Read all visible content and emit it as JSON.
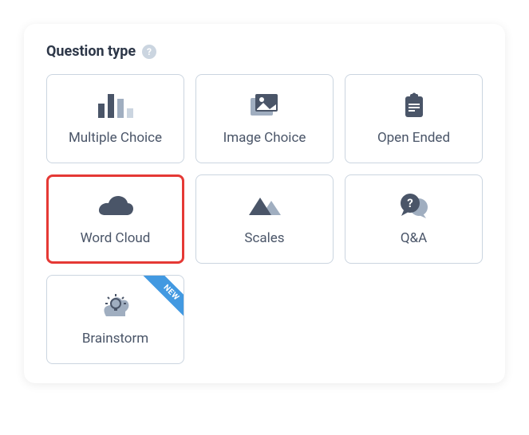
{
  "header": {
    "title": "Question type",
    "helpGlyph": "?"
  },
  "options": [
    {
      "id": "multiple-choice",
      "label": "Multiple Choice",
      "icon": "bar-chart-icon",
      "selected": false,
      "badge": null
    },
    {
      "id": "image-choice",
      "label": "Image Choice",
      "icon": "image-stack-icon",
      "selected": false,
      "badge": null
    },
    {
      "id": "open-ended",
      "label": "Open Ended",
      "icon": "clipboard-icon",
      "selected": false,
      "badge": null
    },
    {
      "id": "word-cloud",
      "label": "Word Cloud",
      "icon": "cloud-icon",
      "selected": true,
      "badge": null
    },
    {
      "id": "scales",
      "label": "Scales",
      "icon": "mountain-icon",
      "selected": false,
      "badge": null
    },
    {
      "id": "qa",
      "label": "Q&A",
      "icon": "question-bubble-icon",
      "selected": false,
      "badge": null
    },
    {
      "id": "brainstorm",
      "label": "Brainstorm",
      "icon": "lightbulb-icon",
      "selected": false,
      "badge": "NEW"
    }
  ],
  "colors": {
    "selectedBorder": "#e53935",
    "ribbon": "#4299e1",
    "iconPrimary": "#4a5568",
    "iconSecondary": "#a0aec0"
  }
}
